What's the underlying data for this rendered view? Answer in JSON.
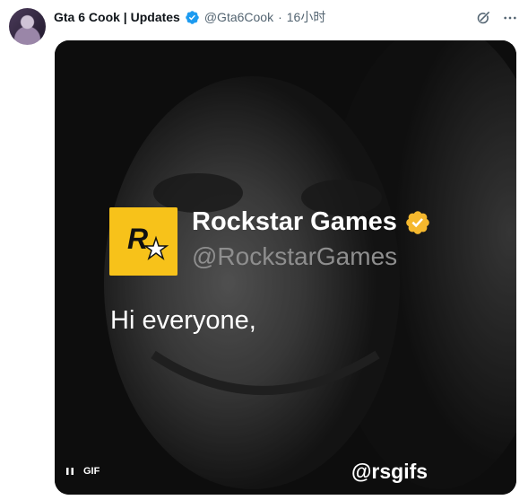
{
  "tweet": {
    "display_name": "Gta 6 Cook | Updates",
    "handle": "@Gta6Cook",
    "separator": "·",
    "time": "16小时",
    "verified_color": "#1d9bf0"
  },
  "media": {
    "type": "GIF",
    "gif_label": "GIF",
    "card": {
      "name": "Rockstar Games",
      "handle": "@RockstarGames",
      "text": "Hi everyone,",
      "logo_color": "#f7c21a",
      "check_color": "#f5b82e"
    },
    "watermark": "@rsgifs"
  },
  "icons": {
    "grok": "grok-icon",
    "more": "more-icon",
    "pause": "pause-icon"
  }
}
